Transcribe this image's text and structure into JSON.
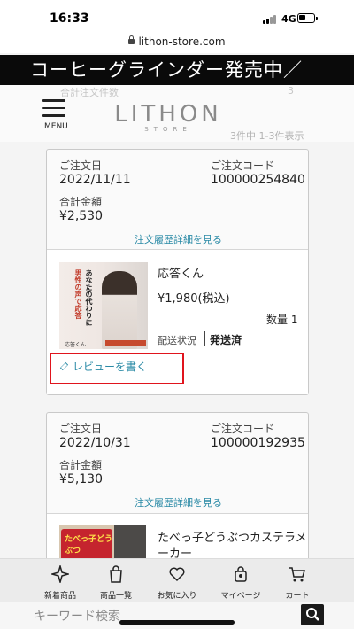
{
  "status_bar": {
    "time": "16:33",
    "network": "4G"
  },
  "browser": {
    "url": "lithon-store.com"
  },
  "banner": {
    "text": "コーヒーグラインダー発売中／"
  },
  "header": {
    "faint_label": "合計注文件数",
    "faint_count": "3",
    "menu_label": "MENU",
    "logo_main": "LITHON",
    "logo_sub": "STORE",
    "result_count": "3件中 1-3件表示"
  },
  "orders": [
    {
      "date_label": "ご注文日",
      "date": "2022/11/11",
      "code_label": "ご注文コード",
      "code": "100000254840",
      "total_label": "合計金額",
      "total": "¥2,530",
      "detail_link": "注文履歴詳細を見る",
      "item": {
        "name": "応答くん",
        "price": "¥1,980(税込)",
        "quantity": "数量 1",
        "ship_label": "配送状況",
        "ship_status": "発送済",
        "review_label": "レビューを書く",
        "thumb_text_a": "あなたの代わりに",
        "thumb_text_b": "男性の声で応答",
        "thumb_caption": "応答くん"
      }
    },
    {
      "date_label": "ご注文日",
      "date": "2022/10/31",
      "code_label": "ご注文コード",
      "code": "100000192935",
      "total_label": "合計金額",
      "total": "¥5,130",
      "detail_link": "注文履歴詳細を見る",
      "item": {
        "name_line1": "たべっ子どうぶつカステラメ",
        "name_line2": "ーカー",
        "thumb_text": "たべっ子どうぶつ"
      }
    }
  ],
  "bottom_nav": [
    {
      "label": "新着商品",
      "icon": "sparkle-icon"
    },
    {
      "label": "商品一覧",
      "icon": "shopping-bag-icon"
    },
    {
      "label": "お気に入り",
      "icon": "heart-icon"
    },
    {
      "label": "マイページ",
      "icon": "user-bag-icon"
    },
    {
      "label": "カート",
      "icon": "cart-icon"
    }
  ],
  "search": {
    "placeholder": "キーワード検索"
  },
  "colors": {
    "link": "#2a8aa6",
    "highlight": "#e0141d",
    "banner_bg": "#0a0a0a"
  }
}
